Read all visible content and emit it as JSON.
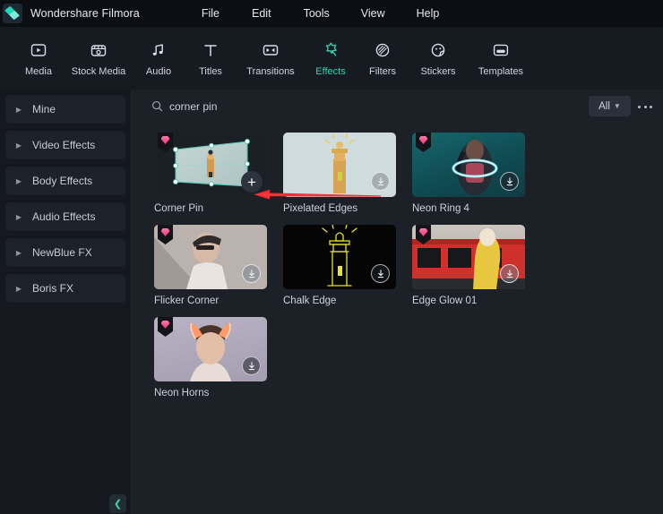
{
  "window": {
    "app_title": "Wondershare Filmora",
    "logo_icon": "filmora-logo-icon"
  },
  "menubar": {
    "items": [
      {
        "label": "File"
      },
      {
        "label": "Edit"
      },
      {
        "label": "Tools"
      },
      {
        "label": "View"
      },
      {
        "label": "Help"
      }
    ]
  },
  "toolbar": {
    "active": "Effects",
    "items": [
      {
        "label": "Media",
        "icon": "media-icon",
        "active": false
      },
      {
        "label": "Stock Media",
        "icon": "stock-media-icon",
        "active": false
      },
      {
        "label": "Audio",
        "icon": "audio-note-icon",
        "active": false
      },
      {
        "label": "Titles",
        "icon": "titles-text-icon",
        "active": false
      },
      {
        "label": "Transitions",
        "icon": "transitions-icon",
        "active": false
      },
      {
        "label": "Effects",
        "icon": "effects-wand-icon",
        "active": true
      },
      {
        "label": "Filters",
        "icon": "filters-icon",
        "active": false
      },
      {
        "label": "Stickers",
        "icon": "stickers-face-icon",
        "active": false
      },
      {
        "label": "Templates",
        "icon": "templates-icon",
        "active": false
      }
    ]
  },
  "sidebar": {
    "items": [
      {
        "label": "Mine",
        "expand_icon": "chevron-right-icon"
      },
      {
        "label": "Video Effects",
        "expand_icon": "chevron-right-icon"
      },
      {
        "label": "Body Effects",
        "expand_icon": "chevron-right-icon"
      },
      {
        "label": "Audio Effects",
        "expand_icon": "chevron-right-icon"
      },
      {
        "label": "NewBlue FX",
        "expand_icon": "chevron-right-icon"
      },
      {
        "label": "Boris FX",
        "expand_icon": "chevron-right-icon"
      }
    ],
    "collapse_icon": "chevron-left-icon"
  },
  "search": {
    "value": "corner pin",
    "placeholder": "Search",
    "icon": "search-icon"
  },
  "filter": {
    "selected": "All",
    "chevron_icon": "chevron-down-icon",
    "more_icon": "more-options-icon"
  },
  "annotation": {
    "arrow_color": "#e8202a",
    "icon": "red-arrow-left-icon"
  },
  "results": {
    "cards": [
      {
        "label": "Corner Pin",
        "art": "art-cornerpin",
        "pro": true,
        "download": false,
        "add": true
      },
      {
        "label": "Pixelated Edges",
        "art": "art-pixel",
        "pro": false,
        "download": true,
        "add": false
      },
      {
        "label": "Neon Ring 4",
        "art": "art-neonring",
        "pro": true,
        "download": true,
        "add": false
      },
      {
        "label": "Flicker Corner",
        "art": "art-flicker",
        "pro": true,
        "download": true,
        "add": false
      },
      {
        "label": "Chalk Edge",
        "art": "art-chalk",
        "pro": false,
        "download": true,
        "add": false
      },
      {
        "label": "Edge Glow 01",
        "art": "art-edgeglow",
        "pro": true,
        "download": true,
        "add": false
      },
      {
        "label": "Neon Horns",
        "art": "art-horns",
        "pro": true,
        "download": true,
        "add": false
      }
    ]
  },
  "colors": {
    "accent": "#35d4aa",
    "premium_badge": "#f0327e",
    "panel_bg": "#1c2027",
    "sidebar_bg": "#15181e",
    "titlebar_bg": "#0b0f14"
  }
}
